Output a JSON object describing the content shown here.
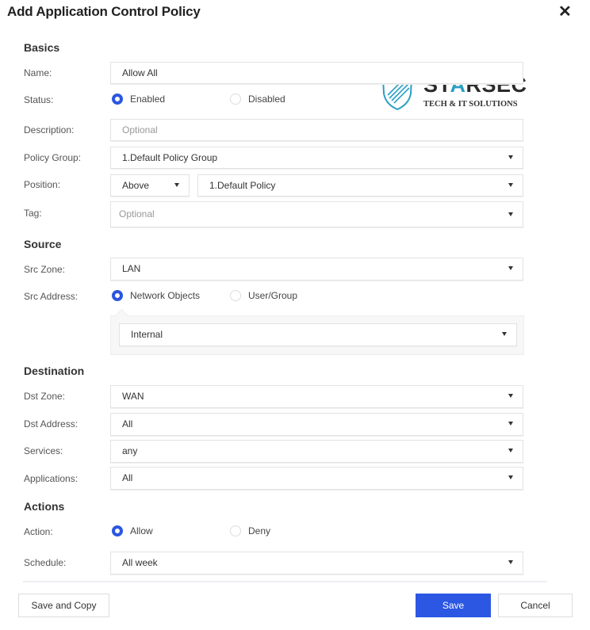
{
  "dialog": {
    "title": "Add Application Control Policy",
    "close_icon": "close-icon"
  },
  "watermark": {
    "brand_prefix": "ST",
    "brand_accent": "A",
    "brand_suffix": "RSEC",
    "tagline": "TECH & IT SOLUTIONS",
    "icon": "shield-icon",
    "accent_color": "#2a9fc4"
  },
  "basics": {
    "heading": "Basics",
    "name": {
      "label": "Name:",
      "value": "Allow All"
    },
    "status": {
      "label": "Status:",
      "options": [
        "Enabled",
        "Disabled"
      ],
      "selected": "Enabled"
    },
    "description": {
      "label": "Description:",
      "placeholder": "Optional"
    },
    "policy_group": {
      "label": "Policy Group:",
      "value": "1.Default Policy Group"
    },
    "position": {
      "label": "Position:",
      "relation": "Above",
      "policy": "1.Default Policy"
    },
    "tag": {
      "label": "Tag:",
      "placeholder": "Optional"
    }
  },
  "source": {
    "heading": "Source",
    "src_zone": {
      "label": "Src Zone:",
      "value": "LAN"
    },
    "src_address": {
      "label": "Src Address:",
      "options": [
        "Network Objects",
        "User/Group"
      ],
      "selected": "Network Objects",
      "value": "Internal"
    }
  },
  "destination": {
    "heading": "Destination",
    "dst_zone": {
      "label": "Dst Zone:",
      "value": "WAN"
    },
    "dst_address": {
      "label": "Dst Address:",
      "value": "All"
    },
    "services": {
      "label": "Services:",
      "value": "any"
    },
    "applications": {
      "label": "Applications:",
      "value": "All"
    }
  },
  "actions": {
    "heading": "Actions",
    "action": {
      "label": "Action:",
      "options": [
        "Allow",
        "Deny"
      ],
      "selected": "Allow"
    },
    "schedule": {
      "label": "Schedule:",
      "value": "All week"
    }
  },
  "footer": {
    "save_and_copy": "Save and Copy",
    "save": "Save",
    "cancel": "Cancel"
  },
  "colors": {
    "primary": "#2c57e3",
    "radio_selected": "#2a56e0"
  }
}
